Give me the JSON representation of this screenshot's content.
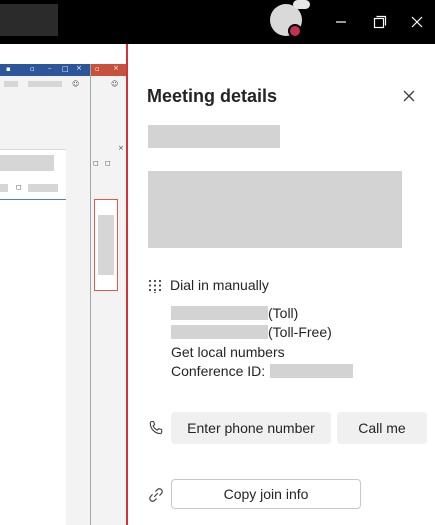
{
  "titlebar": {
    "minimize_icon": "minimize-icon",
    "maximize_icon": "restore-icon",
    "close_icon": "close-icon"
  },
  "panel": {
    "title": "Meeting details",
    "dial_in": {
      "label": "Dial in manually",
      "toll_suffix": "(Toll)",
      "toll_free_suffix": "(Toll-Free)",
      "local_numbers": "Get local numbers",
      "conference_label": "Conference ID:"
    },
    "actions": {
      "enter_phone": "Enter phone number",
      "call_me": "Call me",
      "copy_join": "Copy join info"
    }
  },
  "colors": {
    "accent_red": "#d13438",
    "status_red": "#c4314b",
    "panel_bg": "#ffffff",
    "titlebar_bg": "#000000"
  }
}
